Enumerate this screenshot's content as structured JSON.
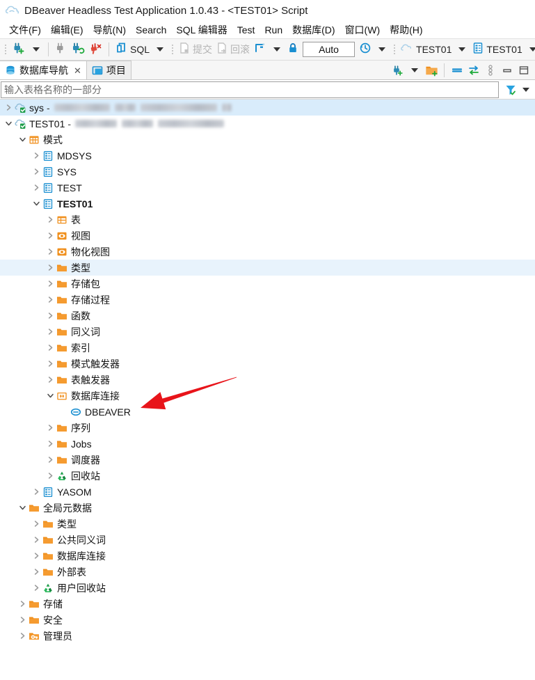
{
  "window": {
    "title": "DBeaver Headless Test Application 1.0.43 - <TEST01> Script",
    "app_icon": "dbeaver-cloud-icon"
  },
  "menubar": {
    "items": [
      {
        "label": "文件(F)",
        "name": "menu-file"
      },
      {
        "label": "编辑(E)",
        "name": "menu-edit"
      },
      {
        "label": "导航(N)",
        "name": "menu-navigate"
      },
      {
        "label": "Search",
        "name": "menu-search"
      },
      {
        "label": "SQL 编辑器",
        "name": "menu-sql-editor"
      },
      {
        "label": "Test",
        "name": "menu-test"
      },
      {
        "label": "Run",
        "name": "menu-run"
      },
      {
        "label": "数据库(D)",
        "name": "menu-database"
      },
      {
        "label": "窗口(W)",
        "name": "menu-window"
      },
      {
        "label": "帮助(H)",
        "name": "menu-help"
      }
    ]
  },
  "toolbar": {
    "new_connection_icon": "new-connection-plug-plus-icon",
    "disconnect_icon": "disconnect-plug-gray-icon",
    "reconnect_icon": "reconnect-plug-refresh-icon",
    "invalidate_icon": "disconnect-plug-red-icon",
    "sql_label": "SQL",
    "sql_icon": "sql-editor-icon",
    "commit_label": "提交",
    "commit_icon": "commit-icon",
    "rollback_label": "回滚",
    "rollback_icon": "rollback-icon",
    "transaction_mode_icon": "transaction-mode-icon",
    "lock_icon": "lock-blue-icon",
    "auto_value": "Auto",
    "history_icon": "transaction-log-clock-icon",
    "connection_label": "TEST01",
    "connection_icon": "connection-cloud-icon",
    "schema_label": "TEST01",
    "schema_icon": "schema-database-icon"
  },
  "view_tabs": {
    "tabs": [
      {
        "label": "数据库导航",
        "icon": "database-navigator-icon",
        "active": true,
        "closable": true
      },
      {
        "label": "项目",
        "icon": "projects-folder-icon",
        "active": false,
        "closable": false
      }
    ],
    "tools": [
      {
        "name": "new-connection-button",
        "icon": "new-connection-plug-plus-icon"
      },
      {
        "name": "new-connection-dropdown",
        "icon": "chevron-down-icon"
      },
      {
        "name": "new-folder-button",
        "icon": "new-folder-plus-icon"
      },
      {
        "name": "collapse-all-button",
        "icon": "collapse-all-icon"
      },
      {
        "name": "link-editor-button",
        "icon": "link-with-editor-icon"
      },
      {
        "name": "view-menu-button",
        "icon": "view-menu-dots-icon"
      },
      {
        "name": "minimize-button",
        "icon": "minimize-icon"
      },
      {
        "name": "maximize-button",
        "icon": "maximize-icon"
      }
    ]
  },
  "filter": {
    "placeholder": "输入表格名称的一部分",
    "value": "",
    "filter_icon": "filter-funnel-icon",
    "filter_dropdown_icon": "chevron-down-icon"
  },
  "tree": {
    "rows": [
      {
        "label": "sys",
        "indent": 0,
        "twisty": "collapsed",
        "icon": "connection-cloud-icon",
        "selected": true,
        "redacted": [
          80,
          30,
          110,
          14
        ],
        "bold": false,
        "dash": "-"
      },
      {
        "label": "TEST01",
        "indent": 0,
        "twisty": "expanded",
        "icon": "connection-cloud-icon",
        "selected": false,
        "redacted": [
          60,
          45,
          95
        ],
        "bold": false,
        "dash": "-"
      },
      {
        "label": "模式",
        "indent": 1,
        "twisty": "expanded",
        "icon": "schemas-grid-icon",
        "selected": false,
        "bold": false
      },
      {
        "label": "MDSYS",
        "indent": 2,
        "twisty": "collapsed",
        "icon": "schema-database-icon",
        "selected": false,
        "bold": false
      },
      {
        "label": "SYS",
        "indent": 2,
        "twisty": "collapsed",
        "icon": "schema-database-icon",
        "selected": false,
        "bold": false
      },
      {
        "label": "TEST",
        "indent": 2,
        "twisty": "collapsed",
        "icon": "schema-database-icon",
        "selected": false,
        "bold": false
      },
      {
        "label": "TEST01",
        "indent": 2,
        "twisty": "expanded",
        "icon": "schema-database-icon",
        "selected": false,
        "bold": true
      },
      {
        "label": "表",
        "indent": 3,
        "twisty": "collapsed",
        "icon": "table-icon",
        "selected": false,
        "bold": false
      },
      {
        "label": "视图",
        "indent": 3,
        "twisty": "collapsed",
        "icon": "view-eye-icon",
        "selected": false,
        "bold": false
      },
      {
        "label": "物化视图",
        "indent": 3,
        "twisty": "collapsed",
        "icon": "view-eye-icon",
        "selected": false,
        "bold": false
      },
      {
        "label": "类型",
        "indent": 3,
        "twisty": "collapsed",
        "icon": "folder-icon",
        "selected": false,
        "highlighted": true,
        "bold": false
      },
      {
        "label": "存储包",
        "indent": 3,
        "twisty": "collapsed",
        "icon": "folder-icon",
        "selected": false,
        "bold": false
      },
      {
        "label": "存储过程",
        "indent": 3,
        "twisty": "collapsed",
        "icon": "folder-icon",
        "selected": false,
        "bold": false
      },
      {
        "label": "函数",
        "indent": 3,
        "twisty": "collapsed",
        "icon": "folder-icon",
        "selected": false,
        "bold": false
      },
      {
        "label": "同义词",
        "indent": 3,
        "twisty": "collapsed",
        "icon": "folder-icon",
        "selected": false,
        "bold": false
      },
      {
        "label": "索引",
        "indent": 3,
        "twisty": "collapsed",
        "icon": "folder-icon",
        "selected": false,
        "bold": false
      },
      {
        "label": "模式触发器",
        "indent": 3,
        "twisty": "collapsed",
        "icon": "folder-icon",
        "selected": false,
        "bold": false
      },
      {
        "label": "表触发器",
        "indent": 3,
        "twisty": "collapsed",
        "icon": "folder-icon",
        "selected": false,
        "bold": false
      },
      {
        "label": "数据库连接",
        "indent": 3,
        "twisty": "expanded",
        "icon": "db-link-folder-icon",
        "selected": false,
        "bold": false
      },
      {
        "label": "DBEAVER",
        "indent": 4,
        "twisty": "none",
        "icon": "db-link-icon",
        "selected": false,
        "bold": false
      },
      {
        "label": "序列",
        "indent": 3,
        "twisty": "collapsed",
        "icon": "folder-icon",
        "selected": false,
        "bold": false
      },
      {
        "label": "Jobs",
        "indent": 3,
        "twisty": "collapsed",
        "icon": "folder-icon",
        "selected": false,
        "bold": false
      },
      {
        "label": "调度器",
        "indent": 3,
        "twisty": "collapsed",
        "icon": "folder-icon",
        "selected": false,
        "bold": false
      },
      {
        "label": "回收站",
        "indent": 3,
        "twisty": "collapsed",
        "icon": "recycle-bin-icon",
        "selected": false,
        "bold": false
      },
      {
        "label": "YASOM",
        "indent": 2,
        "twisty": "collapsed",
        "icon": "schema-database-icon",
        "selected": false,
        "bold": false
      },
      {
        "label": "全局元数据",
        "indent": 1,
        "twisty": "expanded",
        "icon": "folder-icon",
        "selected": false,
        "bold": false
      },
      {
        "label": "类型",
        "indent": 2,
        "twisty": "collapsed",
        "icon": "folder-icon",
        "selected": false,
        "bold": false
      },
      {
        "label": "公共同义词",
        "indent": 2,
        "twisty": "collapsed",
        "icon": "folder-icon",
        "selected": false,
        "bold": false
      },
      {
        "label": "数据库连接",
        "indent": 2,
        "twisty": "collapsed",
        "icon": "folder-icon",
        "selected": false,
        "bold": false
      },
      {
        "label": "外部表",
        "indent": 2,
        "twisty": "collapsed",
        "icon": "folder-icon",
        "selected": false,
        "bold": false
      },
      {
        "label": "用户回收站",
        "indent": 2,
        "twisty": "collapsed",
        "icon": "recycle-bin-icon",
        "selected": false,
        "bold": false
      },
      {
        "label": "存储",
        "indent": 1,
        "twisty": "collapsed",
        "icon": "folder-icon",
        "selected": false,
        "bold": false
      },
      {
        "label": "安全",
        "indent": 1,
        "twisty": "collapsed",
        "icon": "folder-icon",
        "selected": false,
        "bold": false
      },
      {
        "label": "管理员",
        "indent": 1,
        "twisty": "collapsed",
        "icon": "admin-folder-icon",
        "selected": false,
        "bold": false
      }
    ]
  },
  "annotation": {
    "arrow_color": "#e8141a",
    "name": "red-pointer-arrow",
    "points_to": "DBEAVER"
  },
  "colors": {
    "selection": "#d9ecfb",
    "highlight": "#e8f3fc",
    "folder_orange": "#f0901e",
    "accent_blue": "#1a8fd1",
    "arrow_red": "#e8141a"
  }
}
